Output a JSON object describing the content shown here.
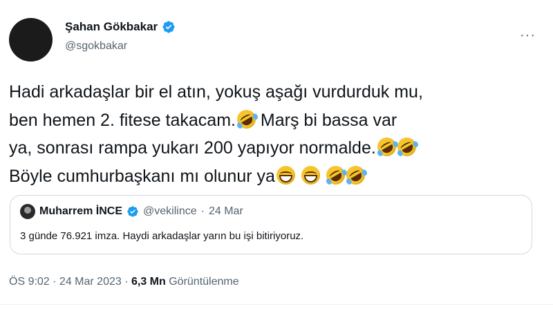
{
  "author": {
    "name": "Şahan Gökbakar",
    "handle": "@sgokbakar",
    "verified": true
  },
  "more_label": "···",
  "tweet": {
    "line1": "Hadi arkadaşlar bir el atın, yokuş aşağı vurdurduk mu,",
    "line2": "ben hemen 2. fitese takacam.",
    "line2b": " Marş bi bassa var",
    "line3": "ya, sonrası rampa yukarı 200 yapıyor normalde.",
    "line4": "Böyle cumhurbaşkanı mı olunur ya"
  },
  "emoji": {
    "rofl": "rolling-on-floor-laughing",
    "grin": "grinning-face-with-smiling-eyes"
  },
  "quote": {
    "name": "Muharrem İNCE",
    "handle": "@vekilince",
    "separator": "·",
    "date": "24 Mar",
    "text": "3 günde 76.921 imza. Haydi arkadaşlar yarın bu işi bitiriyoruz."
  },
  "meta": {
    "time": "ÖS 9:02",
    "sep1": " · ",
    "date": "24 Mar 2023",
    "sep2": " · ",
    "views_count": "6,3 Mn",
    "views_label": " Görüntülenme"
  },
  "colors": {
    "verified_blue": "#1d9bf0",
    "secondary_text": "#536471",
    "primary_text": "#0f1419"
  }
}
